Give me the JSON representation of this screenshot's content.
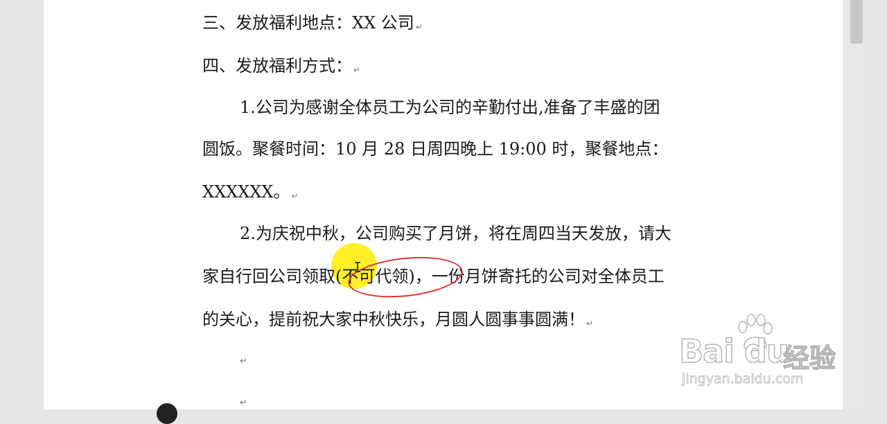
{
  "document": {
    "lines": [
      "三、发放福利地点：XX 公司",
      "四、发放福利方式：",
      "1.公司为感谢全体员工为公司的辛勤付出,准备了丰盛的团",
      "圆饭。聚餐时间：10 月 28 日周四晚上 19:00 时，聚餐地点：",
      "XXXXXX。",
      "2.为庆祝中秋，公司购买了月饼，将在周四当天发放，请大",
      "家自行回公司领取(不可代领)，一份月饼寄托的公司对全体员工",
      "的关心，提前祝大家中秋快乐，月圆人圆事事圆满！"
    ],
    "paragraph_mark": "↵"
  },
  "watermark": {
    "logo_text": "Bai du",
    "brand_text": "经验",
    "url_text": "jingyan.baidu.com"
  },
  "colors": {
    "highlight": "#ffec00",
    "annotation_ring": "#e23030",
    "text": "#1a1a1a"
  }
}
